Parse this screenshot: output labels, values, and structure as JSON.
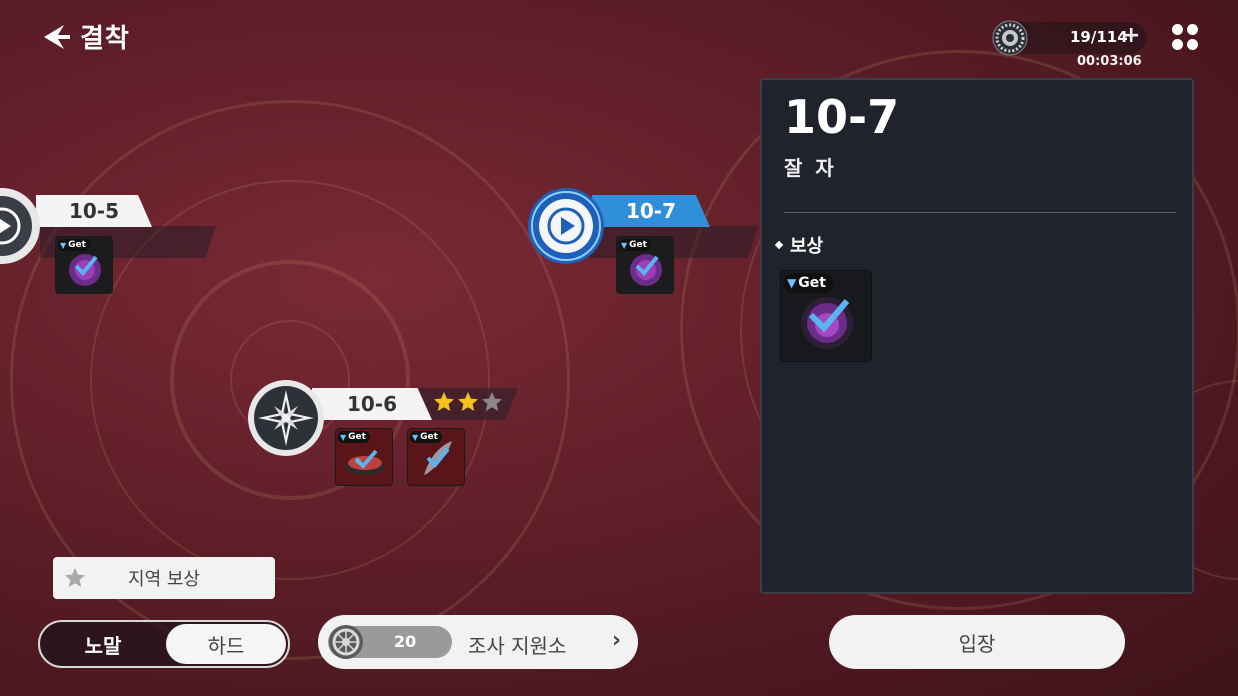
{
  "header": {
    "title": "결착",
    "back_icon": "back-arrow-icon"
  },
  "stamina": {
    "current": "19/114",
    "plus": "+",
    "timer": "00:03:06",
    "icon": "stamina-gear-icon"
  },
  "menu": {
    "icon": "grid-menu-icon"
  },
  "stages": [
    {
      "id": "10-5",
      "label": "10-5",
      "rewards": [
        {
          "tag": "Get"
        }
      ]
    },
    {
      "id": "10-6",
      "label": "10-6",
      "stars_earned": 2,
      "stars_total": 3,
      "rewards": [
        {
          "tag": "Get"
        },
        {
          "tag": "Get"
        }
      ]
    },
    {
      "id": "10-7",
      "label": "10-7",
      "selected": true,
      "rewards": [
        {
          "tag": "Get"
        }
      ]
    }
  ],
  "panel": {
    "title": "10-7",
    "subtitle": "잘 자",
    "reward_heading": "보상",
    "reward_tag": "Get"
  },
  "bottom": {
    "region_reward": "지역 보상",
    "difficulty": {
      "normal": "노말",
      "hard": "하드",
      "selected": "hard"
    },
    "support": {
      "count": "20",
      "label": "조사 지원소",
      "arrow": "›"
    },
    "enter": "입장"
  },
  "colors": {
    "background": "#5e1e28",
    "accent_blue": "#2f8fd9",
    "panel_bg": "#20232b",
    "star_gold": "#f5c21b"
  }
}
